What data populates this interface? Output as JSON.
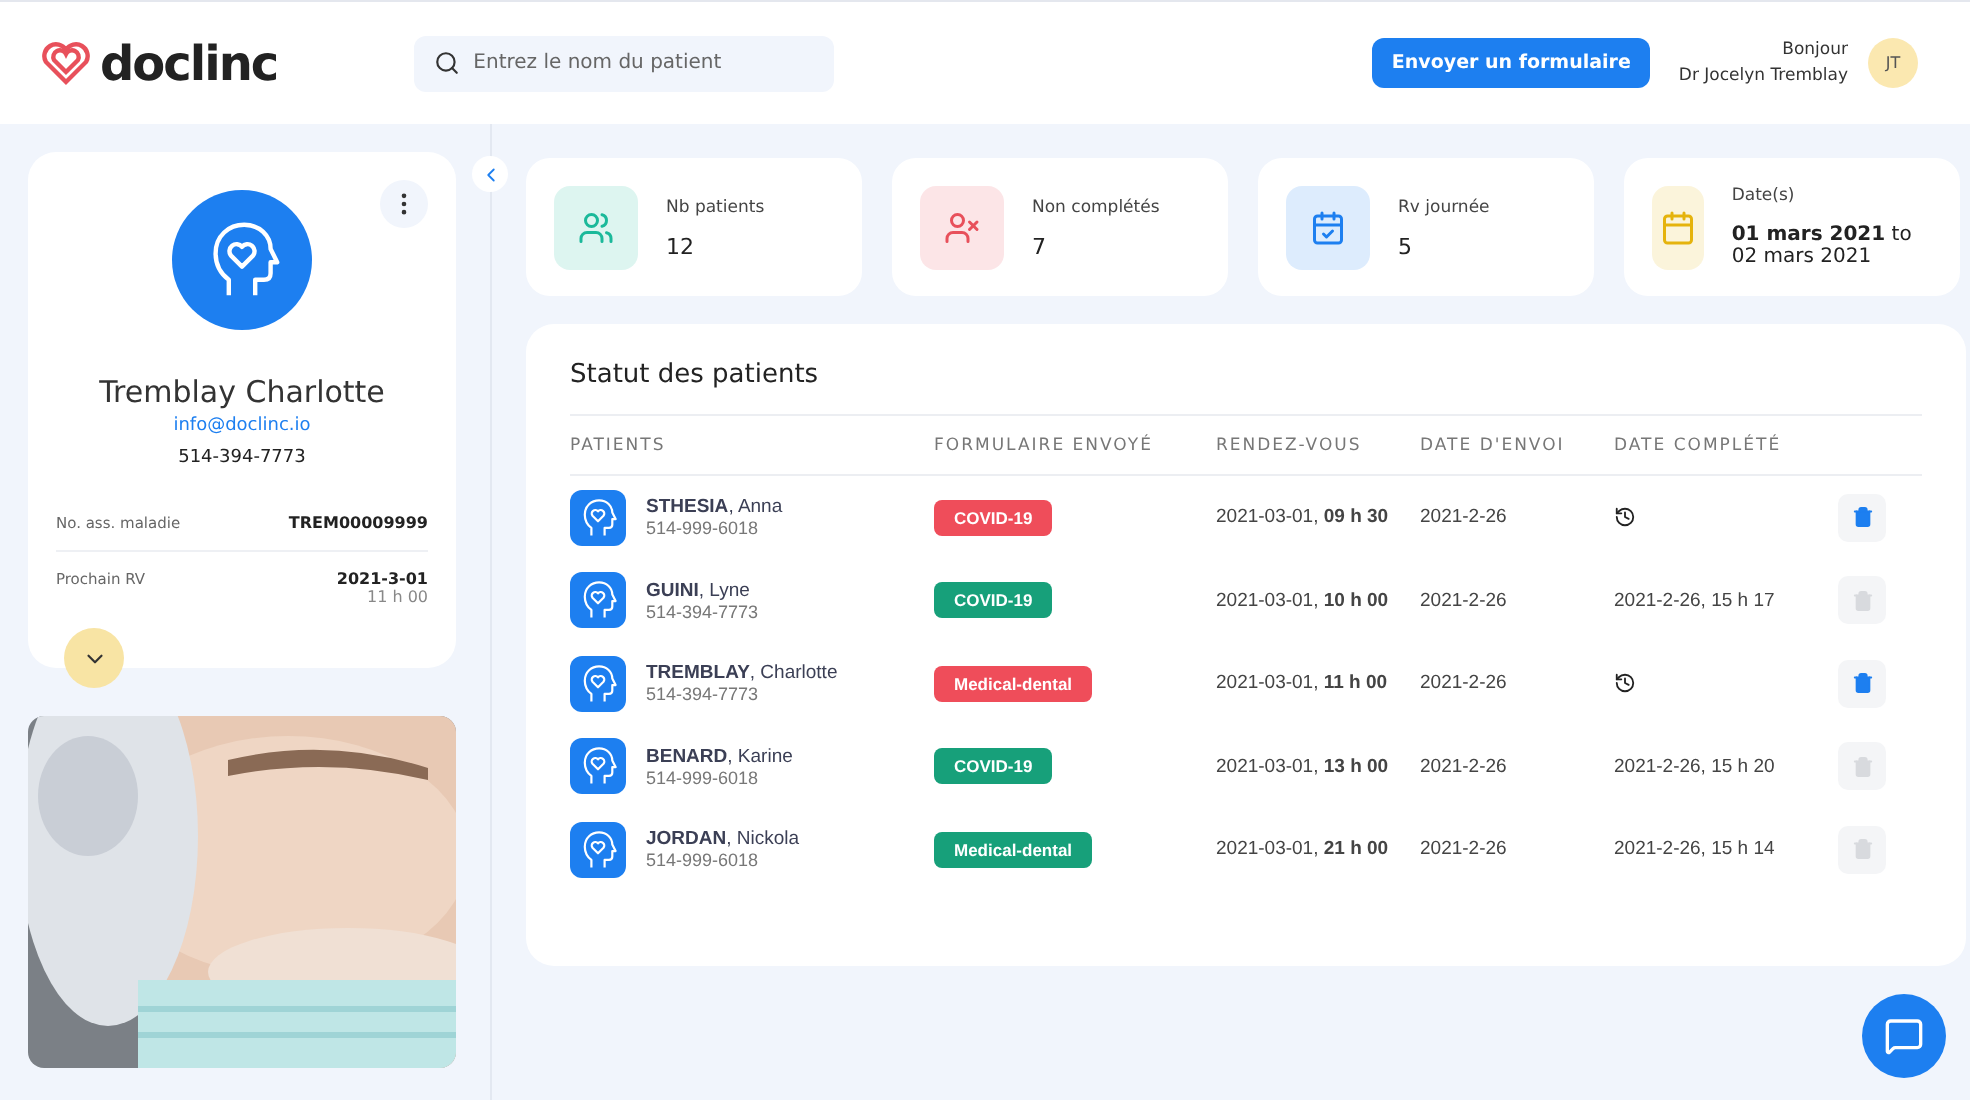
{
  "header": {
    "logo": "doclinc",
    "search": {
      "placeholder": "Entrez le nom du patient"
    },
    "send_button": "Envoyer un formulaire",
    "greeting": "Bonjour",
    "user_name": "Dr Jocelyn Tremblay",
    "avatar": "JT"
  },
  "profile": {
    "name": "Tremblay Charlotte",
    "email": "info@doclinc.io",
    "phone": "514-394-7773",
    "details": [
      {
        "label": "No. ass. maladie",
        "value": "TREM00009999"
      },
      {
        "label": "Prochain RV",
        "value": "2021-3-01",
        "sub": "11 h 00"
      }
    ]
  },
  "stats": [
    {
      "kind": "users",
      "color": "#1bb99a",
      "label": "Nb patients",
      "value": "12"
    },
    {
      "kind": "user-x",
      "color": "#e8505b",
      "label": "Non complétés",
      "value": "7"
    },
    {
      "kind": "calendar-check",
      "color": "#1d7ff0",
      "label": "Rv journée",
      "value": "5"
    },
    {
      "kind": "calendar",
      "color": "#e5b30d",
      "label": "Date(s)",
      "value": "**01 mars 2021** to 02 mars 2021"
    }
  ],
  "table": {
    "title": "Statut des patients",
    "columns": [
      "PATIENTS",
      "FORMULAIRE ENVOYÉ",
      "RENDEZ-VOUS",
      "DATE D'ENVOI",
      "DATE COMPLÉTÉ"
    ],
    "rows": [
      {
        "patient": "**STHESIA**, Anna",
        "phone": "514-999-6018",
        "form": "COVID-19",
        "color": "#ef4d5a",
        "appointment": "2021-03-01, **09 h 30**",
        "sent": "2021-2-26",
        "pending": true,
        "delete_disabled": false
      },
      {
        "patient": "**GUINI**, Lyne",
        "phone": "514-394-7773",
        "form": "COVID-19",
        "color": "#17a07a",
        "appointment": "2021-03-01, **10 h 00**",
        "sent": "2021-2-26",
        "pending": false,
        "completed": "2021-2-26, 15 h 17",
        "delete_disabled": true
      },
      {
        "patient": "**TREMBLAY**, Charlotte",
        "phone": "514-394-7773",
        "form": "Medical-dental",
        "color": "#ef4d5a",
        "appointment": "2021-03-01, **11 h 00**",
        "sent": "2021-2-26",
        "pending": true,
        "delete_disabled": false
      },
      {
        "patient": "**BENARD**, Karine",
        "phone": "514-999-6018",
        "form": "COVID-19",
        "color": "#17a07a",
        "appointment": "2021-03-01, **13 h 00**",
        "sent": "2021-2-26",
        "pending": false,
        "completed": "2021-2-26, 15 h 20",
        "delete_disabled": true
      },
      {
        "patient": "**JORDAN**, Nickola",
        "phone": "514-999-6018",
        "form": "Medical-dental",
        "color": "#17a07a",
        "appointment": "2021-03-01, **21 h 00**",
        "sent": "2021-2-26",
        "pending": false,
        "completed": "2021-2-26, 15 h 14",
        "delete_disabled": true
      }
    ]
  }
}
